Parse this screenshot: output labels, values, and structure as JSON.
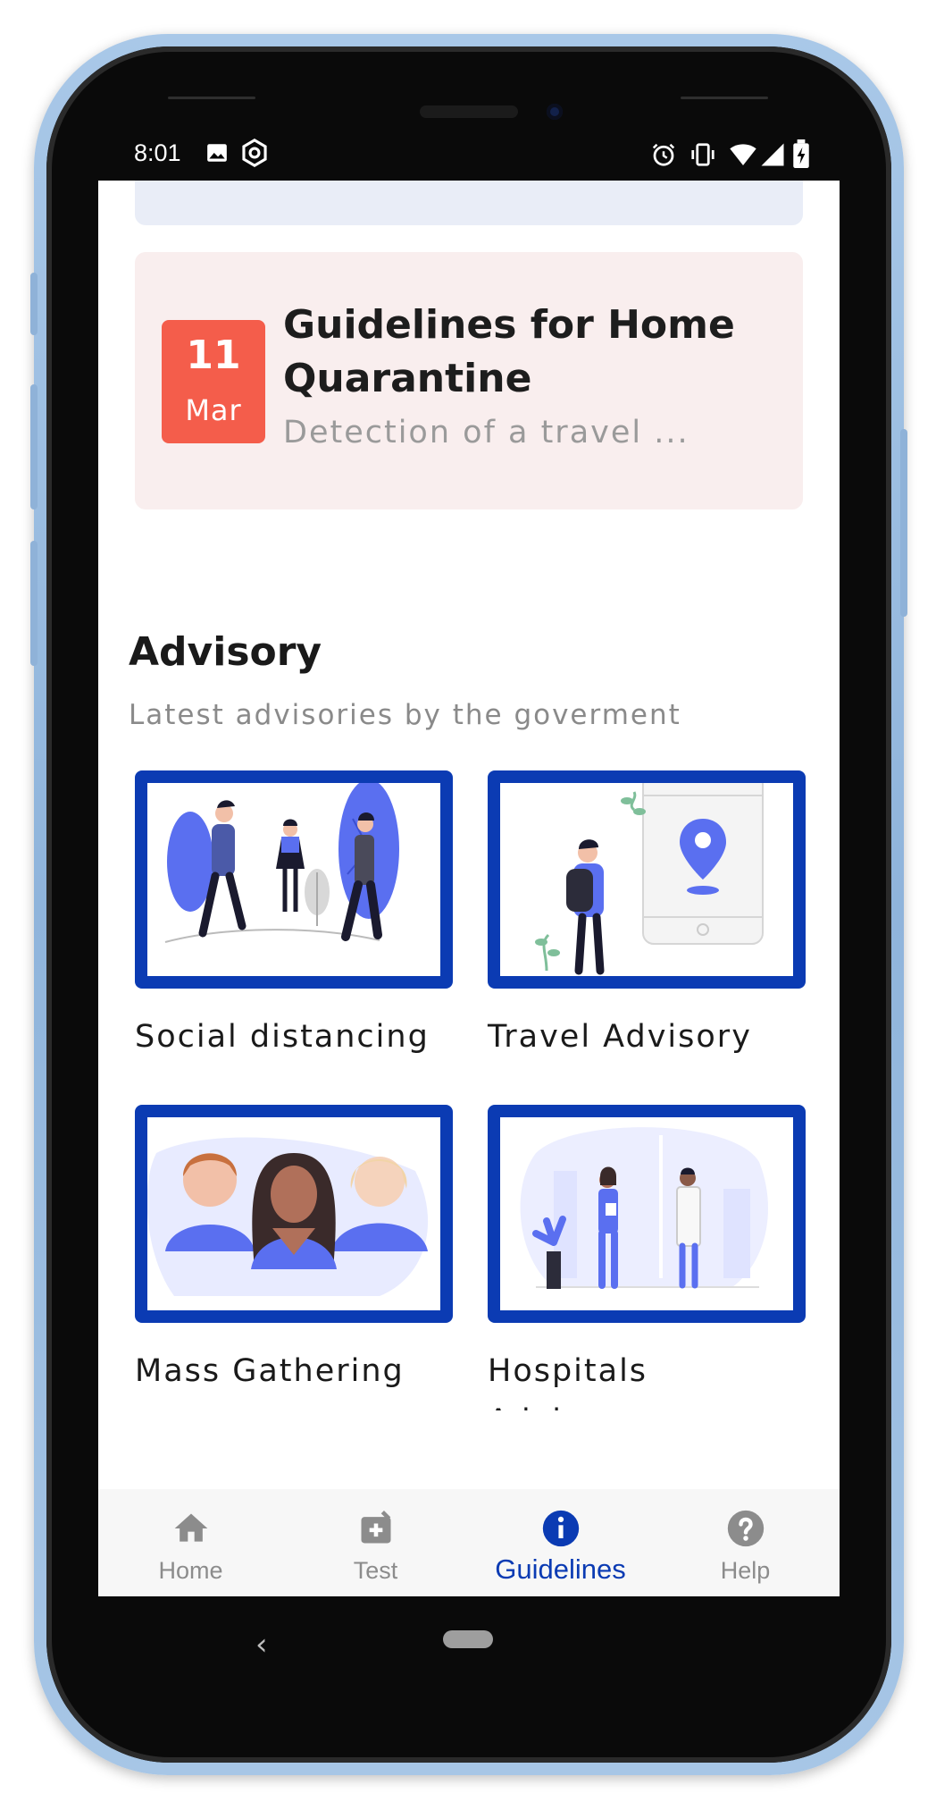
{
  "status_bar": {
    "time": "8:01",
    "left_icons": [
      "image-icon",
      "hexagon-settings-icon"
    ],
    "right_icons": [
      "alarm-icon",
      "vibrate-icon",
      "wifi-icon",
      "signal-icon",
      "battery-icon"
    ]
  },
  "guideline_card": {
    "date_day": "11",
    "date_month": "Mar",
    "title": "Guidelines for Home Quarantine",
    "subtitle": "Detection of a travel ..."
  },
  "advisory": {
    "title": "Advisory",
    "subtitle": "Latest advisories by the goverment",
    "tiles": [
      {
        "label": "Social distancing",
        "image": "social-distancing-illustration"
      },
      {
        "label": "Travel Advisory",
        "image": "travel-advisory-illustration"
      },
      {
        "label": "Mass Gathering",
        "image": "mass-gathering-illustration"
      },
      {
        "label": "Hospitals Advisory",
        "image": "hospitals-advisory-illustration"
      }
    ]
  },
  "bottom_nav": {
    "items": [
      {
        "label": "Home",
        "icon": "home-icon",
        "active": false
      },
      {
        "label": "Test",
        "icon": "test-kit-icon",
        "active": false
      },
      {
        "label": "Guidelines",
        "icon": "info-icon",
        "active": true
      },
      {
        "label": "Help",
        "icon": "help-icon",
        "active": false
      }
    ]
  },
  "colors": {
    "accent": "#0b3bb3",
    "date_badge": "#f45d4b",
    "card_background": "#f9eeee",
    "illustration_blue": "#5a6ff0"
  }
}
